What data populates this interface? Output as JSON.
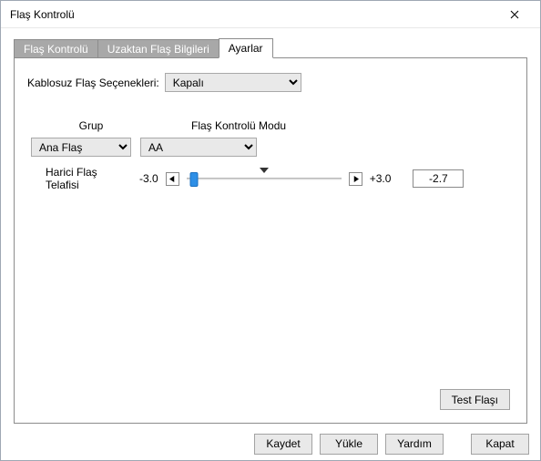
{
  "window": {
    "title": "Flaş Kontrolü"
  },
  "tabs": {
    "t0": "Flaş Kontrolü",
    "t1": "Uzaktan Flaş Bilgileri",
    "t2": "Ayarlar"
  },
  "wireless": {
    "label": "Kablosuz Flaş Seçenekleri:",
    "value": "Kapalı"
  },
  "headers": {
    "group": "Grup",
    "mode": "Flaş Kontrolü Modu"
  },
  "group": {
    "value": "Ana Flaş"
  },
  "mode": {
    "value": "AA"
  },
  "compensation": {
    "label": "Harici Flaş Telafisi",
    "min": "-3.0",
    "max": "+3.0",
    "value": "-2.7",
    "slider_percent": 5
  },
  "buttons": {
    "test": "Test Flaşı",
    "save": "Kaydet",
    "load": "Yükle",
    "help": "Yardım",
    "close": "Kapat"
  }
}
